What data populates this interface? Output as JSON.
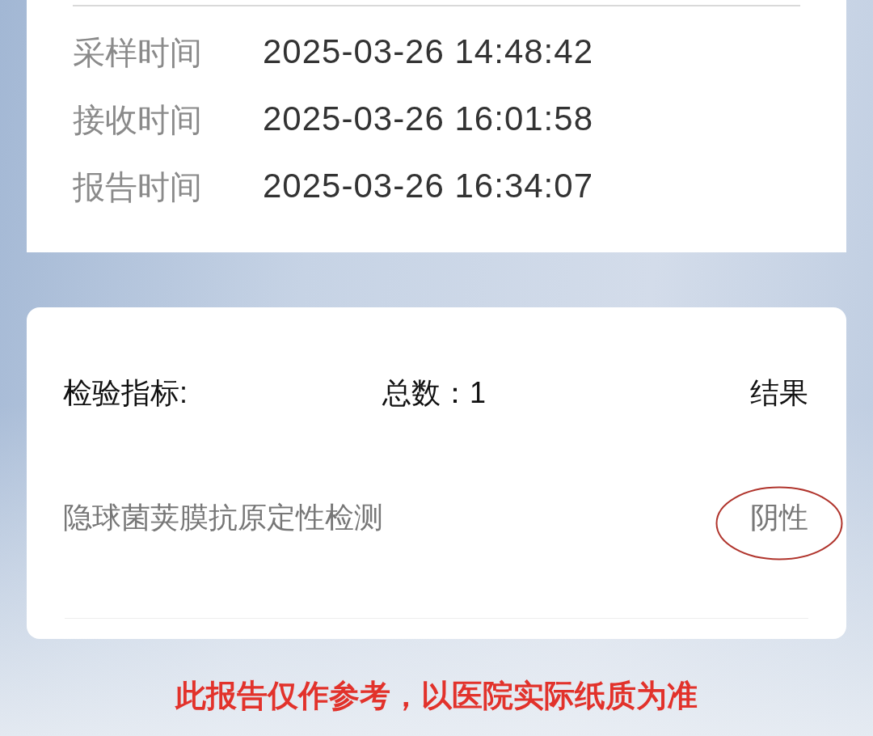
{
  "report_times": [
    {
      "label": "采样时间",
      "value": "2025-03-26 14:48:42"
    },
    {
      "label": "接收时间",
      "value": "2025-03-26 16:01:58"
    },
    {
      "label": "报告时间",
      "value": "2025-03-26 16:34:07"
    }
  ],
  "indicators": {
    "title": "检验指标:",
    "count": "总数：1",
    "result_heading": "结果",
    "items": [
      {
        "name": "隐球菌荚膜抗原定性检测",
        "result": "阴性",
        "circled": true
      }
    ]
  },
  "disclaimer": "此报告仅作参考，以医院实际纸质为准"
}
